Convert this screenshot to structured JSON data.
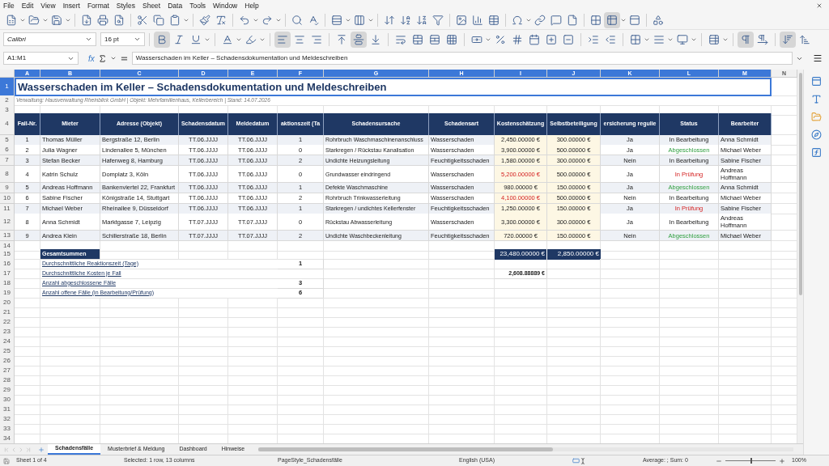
{
  "menu": [
    "File",
    "Edit",
    "View",
    "Insert",
    "Format",
    "Styles",
    "Sheet",
    "Data",
    "Tools",
    "Window",
    "Help"
  ],
  "toolbar": {
    "font_name": "Calibri",
    "font_size": "16 pt",
    "bold": true,
    "align_left": true,
    "center_vertically": true
  },
  "formula_bar": {
    "cell_ref": "A1:M1",
    "function_label": "fx",
    "content": "Wasserschaden im Keller – Schadensdokumentation und Meldeschreiben"
  },
  "columns": [
    {
      "label": "A",
      "selected": true
    },
    {
      "label": "B",
      "selected": true
    },
    {
      "label": "C",
      "selected": true
    },
    {
      "label": "D",
      "selected": true
    },
    {
      "label": "E",
      "selected": true
    },
    {
      "label": "F",
      "selected": true
    },
    {
      "label": "G",
      "selected": true
    },
    {
      "label": "H",
      "selected": true
    },
    {
      "label": "I",
      "selected": true
    },
    {
      "label": "J",
      "selected": true
    },
    {
      "label": "K",
      "selected": true
    },
    {
      "label": "L",
      "selected": true
    },
    {
      "label": "M",
      "selected": true
    },
    {
      "label": "N",
      "selected": false
    }
  ],
  "row_headers": [
    {
      "label": "1",
      "selected": true
    },
    {
      "label": "2",
      "selected": false
    },
    {
      "label": "3",
      "selected": false
    },
    {
      "label": "4",
      "selected": false
    },
    {
      "label": "5",
      "selected": false
    },
    {
      "label": "6",
      "selected": false
    },
    {
      "label": "7",
      "selected": false
    },
    {
      "label": "8",
      "selected": false
    },
    {
      "label": "9",
      "selected": false
    },
    {
      "label": "10",
      "selected": false
    },
    {
      "label": "11",
      "selected": false
    },
    {
      "label": "12",
      "selected": false
    },
    {
      "label": "13",
      "selected": false
    },
    {
      "label": "14",
      "selected": false
    },
    {
      "label": "15",
      "selected": false
    },
    {
      "label": "16",
      "selected": false
    },
    {
      "label": "17",
      "selected": false
    },
    {
      "label": "18",
      "selected": false
    },
    {
      "label": "19",
      "selected": false
    },
    {
      "label": "20",
      "selected": false
    },
    {
      "label": "21",
      "selected": false
    },
    {
      "label": "22",
      "selected": false
    },
    {
      "label": "23",
      "selected": false
    },
    {
      "label": "24",
      "selected": false
    },
    {
      "label": "25",
      "selected": false
    },
    {
      "label": "26",
      "selected": false
    },
    {
      "label": "27",
      "selected": false
    },
    {
      "label": "28",
      "selected": false
    },
    {
      "label": "29",
      "selected": false
    },
    {
      "label": "30",
      "selected": false
    },
    {
      "label": "31",
      "selected": false
    },
    {
      "label": "32",
      "selected": false
    },
    {
      "label": "33",
      "selected": false
    },
    {
      "label": "34",
      "selected": false
    }
  ],
  "title": "Wasserschaden im Keller – Schadensdokumentation und Meldeschreiben",
  "subtitle": "Verwaltung: Hausverwaltung Rheinblick GmbH | Objekt: Mehrfamilienhaus, Kellerbereich | Stand: 14.07.2026",
  "table": {
    "headers": [
      "Fall-Nr.",
      "Mieter",
      "Adresse (Objekt)",
      "Schadensdatum",
      "Meldedatum",
      "aktionszeit (Ta",
      "Schadensursache",
      "Schadensart",
      "Kostenschätzung",
      "Selbstbeteiligung",
      "ersicherung regulie",
      "Status",
      "Bearbeiter"
    ],
    "rows": [
      {
        "cells": [
          "1",
          "Thomas Müller",
          "Bergstraße 12, Berlin",
          "TT.06.JJJJ",
          "TT.06.JJJJ",
          "1",
          "Rohrbruch Waschmaschinenanschluss",
          "Wasserschaden"
        ],
        "cost": {
          "value": "2,450.00000 €",
          "flagged": false
        },
        "deductible": "300.00000 €",
        "insurance": "Ja",
        "status": {
          "label": "In Bearbeitung",
          "kind": "open"
        },
        "handler": "Anna Schmidt"
      },
      {
        "cells": [
          "2",
          "Julia Wagner",
          "Lindenallee 5, München",
          "TT.06.JJJJ",
          "TT.06.JJJJ",
          "0",
          "Starkregen / Rückstau Kanalisation",
          "Wasserschaden"
        ],
        "cost": {
          "value": "3,900.00000 €",
          "flagged": false
        },
        "deductible": "500.00000 €",
        "insurance": "Ja",
        "status": {
          "label": "Abgeschlossen",
          "kind": "done"
        },
        "handler": "Michael Weber"
      },
      {
        "cells": [
          "3",
          "Stefan Becker",
          "Hafenweg 8, Hamburg",
          "TT.06.JJJJ",
          "TT.06.JJJJ",
          "2",
          "Undichte Heizungsleitung",
          "Feuchtigkeitsschaden"
        ],
        "cost": {
          "value": "1,580.00000 €",
          "flagged": false
        },
        "deductible": "300.00000 €",
        "insurance": "Nein",
        "status": {
          "label": "In Bearbeitung",
          "kind": "open"
        },
        "handler": "Sabine Fischer"
      },
      {
        "cells": [
          "4",
          "Katrin Schulz",
          "Domplatz 3, Köln",
          "TT.06.JJJJ",
          "TT.06.JJJJ",
          "0",
          "Grundwasser eindringend",
          "Wasserschaden"
        ],
        "cost": {
          "value": "5,200.00000 €",
          "flagged": true
        },
        "deductible": "500.00000 €",
        "insurance": "Ja",
        "status": {
          "label": "In Prüfung",
          "kind": "review"
        },
        "handler": "Andreas Hoffmann"
      },
      {
        "cells": [
          "5",
          "Andreas Hoffmann",
          "Bankenviertel 22, Frankfurt",
          "TT.06.JJJJ",
          "TT.06.JJJJ",
          "1",
          "Defekte Waschmaschine",
          "Wasserschaden"
        ],
        "cost": {
          "value": "980.00000 €",
          "flagged": false
        },
        "deductible": "150.00000 €",
        "insurance": "Ja",
        "status": {
          "label": "Abgeschlossen",
          "kind": "done"
        },
        "handler": "Anna Schmidt"
      },
      {
        "cells": [
          "6",
          "Sabine Fischer",
          "Königstraße 14, Stuttgart",
          "TT.06.JJJJ",
          "TT.06.JJJJ",
          "2",
          "Rohrbruch Trinkwasserleitung",
          "Wasserschaden"
        ],
        "cost": {
          "value": "4,100.00000 €",
          "flagged": true
        },
        "deductible": "500.00000 €",
        "insurance": "Nein",
        "status": {
          "label": "In Bearbeitung",
          "kind": "open"
        },
        "handler": "Michael Weber"
      },
      {
        "cells": [
          "7",
          "Michael Weber",
          "Rheinallee 9, Düsseldorf",
          "TT.06.JJJJ",
          "TT.06.JJJJ",
          "1",
          "Starkregen / undichtes Kellerfenster",
          "Feuchtigkeitsschaden"
        ],
        "cost": {
          "value": "1,250.00000 €",
          "flagged": false
        },
        "deductible": "150.00000 €",
        "insurance": "Ja",
        "status": {
          "label": "In Prüfung",
          "kind": "review"
        },
        "handler": "Sabine Fischer"
      },
      {
        "cells": [
          "8",
          "Anna Schmidt",
          "Marktgasse 7, Leipzig",
          "TT.07.JJJJ",
          "TT.07.JJJJ",
          "0",
          "Rückstau Abwasserleitung",
          "Wasserschaden"
        ],
        "cost": {
          "value": "3,300.00000 €",
          "flagged": false
        },
        "deductible": "300.00000 €",
        "insurance": "Ja",
        "status": {
          "label": "In Bearbeitung",
          "kind": "open"
        },
        "handler": "Andreas Hoffmann"
      },
      {
        "cells": [
          "9",
          "Andrea Klein",
          "Schillerstraße 18, Berlin",
          "TT.07.JJJJ",
          "TT.07.JJJJ",
          "2",
          "Undichte Waschbeckenleitung",
          "Feuchtigkeitsschaden"
        ],
        "cost": {
          "value": "720.00000 €",
          "flagged": false
        },
        "deductible": "150.00000 €",
        "insurance": "Nein",
        "status": {
          "label": "Abgeschlossen",
          "kind": "done"
        },
        "handler": "Michael Weber"
      }
    ]
  },
  "summary": {
    "title": "Gesamtsummen",
    "total_costs": "23,480.00000 €",
    "total_deductible": "2,850.00000 €",
    "lines": [
      {
        "label": "Durchschnittliche Reaktionszeit (Tage)",
        "kind": "days",
        "value": "1"
      },
      {
        "label": "Durchschnittliche Kosten je Fall",
        "kind": "cost",
        "value": "2,608.88889 €"
      },
      {
        "label": "Anzahl abgeschlossene Fälle",
        "kind": "days",
        "value": "3"
      },
      {
        "label": "Anzahl offene Fälle (in Bearbeitung/Prüfung)",
        "kind": "days",
        "value": "6"
      }
    ]
  },
  "sheet_tabs": [
    {
      "label": "Schadensfälle",
      "selected": true
    },
    {
      "label": "Musterbrief & Meldung",
      "selected": false
    },
    {
      "label": "Dashboard",
      "selected": false
    },
    {
      "label": "Hinweise",
      "selected": false
    }
  ],
  "status_bar": {
    "sheet": "Sheet 1 of 4",
    "selection": "Selected: 1 row, 13 columns",
    "page_style": "PageStyle_Schadensfälle",
    "language": "English (USA)",
    "sum": "Average: ; Sum: 0",
    "zoom": "100%",
    "zoom_slider": {
      "level": 0.5
    }
  }
}
